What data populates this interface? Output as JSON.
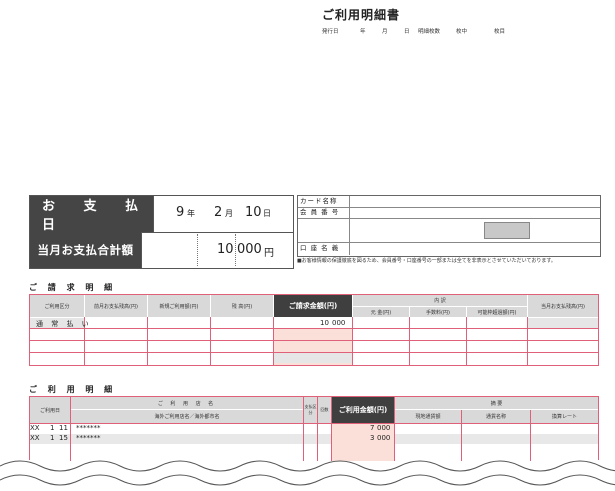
{
  "header": {
    "title": "ご利用明細書",
    "meta": [
      "発行日",
      "年",
      "月",
      "日",
      "明細枚数",
      "枚中",
      "枚目"
    ]
  },
  "payment": {
    "date_label": "お 支 払 日",
    "total_label": "当月お支払合計額",
    "date": {
      "year": "9",
      "year_unit": "年",
      "month": "2",
      "month_unit": "月",
      "day": "10",
      "day_unit": "日"
    },
    "amount": {
      "part1": "10",
      "part2": "000",
      "unit": "円"
    }
  },
  "card_info": {
    "labels": [
      "カード名称",
      "会 員 番 号",
      "",
      "口 座 名 義"
    ],
    "note": "■お客様情報の保護徹底を図るため、会員番号・口座番号の一部または全てを非表示とさせていただいております。"
  },
  "billing": {
    "section_title": "ご 請 求 明 細",
    "headers": [
      "ご利用区分",
      "前月お支払残高(円)",
      "新規ご利用額(円)",
      "残 高(円)",
      "ご請求金額(円)",
      "内 訳",
      "元 金(円)",
      "手数料(円)",
      "可能枠超過額(円)",
      "当月お支払残高(円)"
    ],
    "row": {
      "label": "通 常 払 い",
      "amount_a": "10",
      "amount_b": "000"
    }
  },
  "usage": {
    "section_title": "ご 利 用 明 細",
    "headers": [
      "ご利用日",
      "ご 利 用 店 名",
      "海外ご利用店名／海外都市名",
      "支払区分",
      "回数",
      "ご利用金額(円)",
      "摘 要",
      "現地通貨額",
      "通貨名称",
      "換算レート"
    ],
    "rows": [
      {
        "xx": "XX",
        "m": "1",
        "d": "11",
        "store": "*******",
        "amount_a": "7",
        "amount_b": "000"
      },
      {
        "xx": "XX",
        "m": "1",
        "d": "15",
        "store": "*******",
        "amount_a": "3",
        "amount_b": "000"
      }
    ]
  }
}
